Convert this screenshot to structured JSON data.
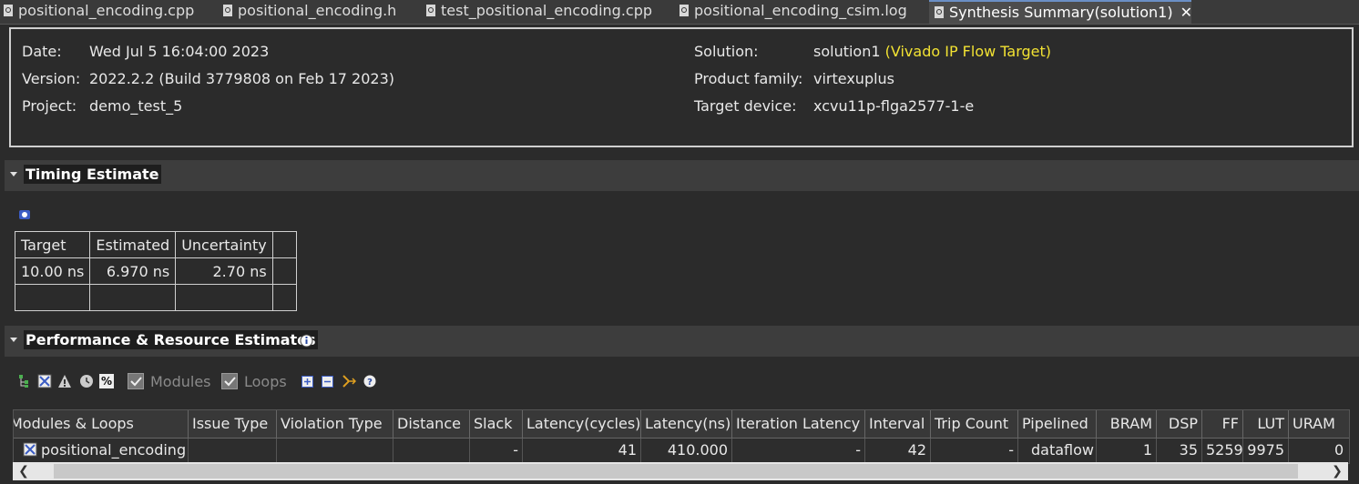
{
  "tabs": [
    {
      "label": "positional_encoding.cpp",
      "icon": "cpp-file-icon"
    },
    {
      "label": "positional_encoding.h",
      "icon": "header-file-icon"
    },
    {
      "label": "test_positional_encoding.cpp",
      "icon": "cpp-file-icon"
    },
    {
      "label": "positional_encoding_csim.log",
      "icon": "log-file-icon"
    },
    {
      "label": "Synthesis Summary(solution1)",
      "icon": "report-icon",
      "active": true,
      "close": "✕"
    }
  ],
  "info": {
    "date_label": "Date:",
    "date": "Wed Jul 5 16:04:00 2023",
    "version_label": "Version:",
    "version": "2022.2.2 (Build 3779808 on Feb 17 2023)",
    "project_label": "Project:",
    "project": "demo_test_5",
    "solution_label": "Solution:",
    "solution": "solution1",
    "solution_target": "(Vivado IP Flow Target)",
    "family_label": "Product family:",
    "family": "virtexuplus",
    "device_label": "Target device:",
    "device": "xcvu11p-flga2577-1-e"
  },
  "timing": {
    "title": "Timing Estimate",
    "headers": [
      "Target",
      "Estimated",
      "Uncertainty"
    ],
    "row": [
      "10.00 ns",
      "6.970 ns",
      "2.70 ns"
    ]
  },
  "perf": {
    "title": "Performance & Resource Estimates",
    "toolbar": {
      "modules_label": "Modules",
      "loops_label": "Loops"
    },
    "columns": [
      "Modules & Loops",
      "Issue Type",
      "Violation Type",
      "Distance",
      "Slack",
      "Latency(cycles)",
      "Latency(ns)",
      "Iteration Latency",
      "Interval",
      "Trip Count",
      "Pipelined",
      "BRAM",
      "DSP",
      "FF",
      "LUT",
      "URAM"
    ],
    "row": [
      "positional_encoding",
      "",
      "",
      "",
      "-",
      "41",
      "410.000",
      "-",
      "42",
      "-",
      "dataflow",
      "1",
      "35",
      "5259",
      "9975",
      "0"
    ]
  },
  "colors": {
    "accent": "#f2e233",
    "background": "#2b2b2b"
  }
}
